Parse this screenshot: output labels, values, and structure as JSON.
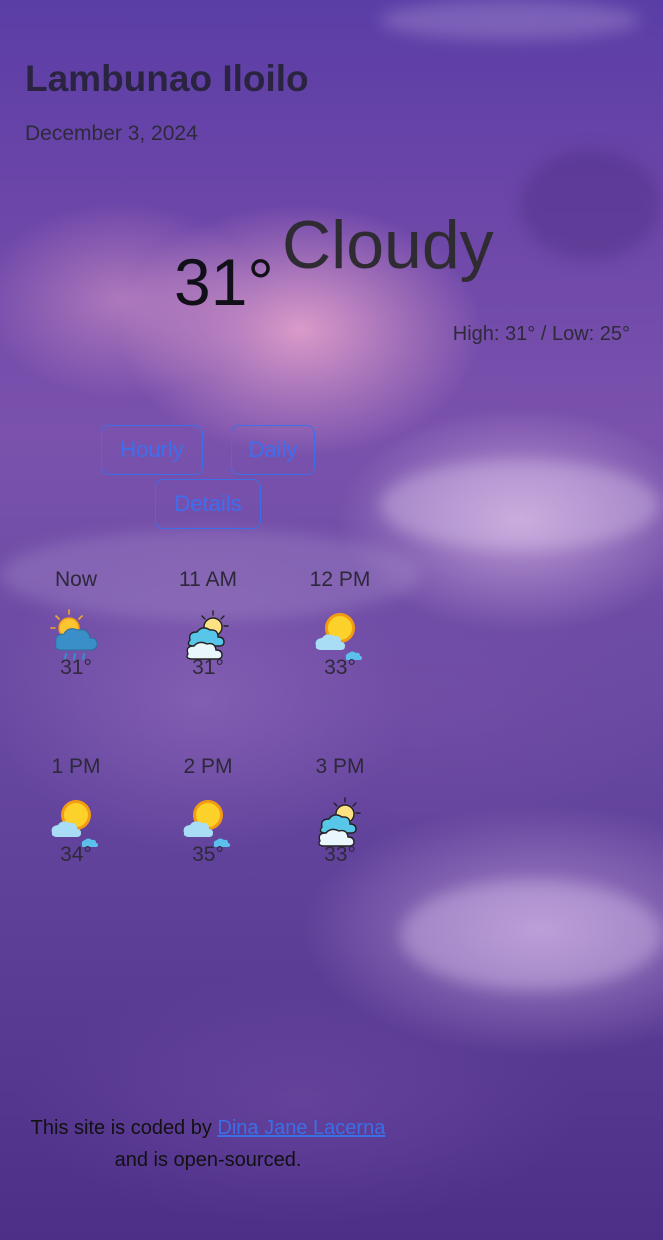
{
  "location": "Lambunao Iloilo",
  "date": "December 3, 2024",
  "current": {
    "temperature": "31°",
    "condition": "Cloudy",
    "high_low": "High: 31° / Low: 25°"
  },
  "tabs": {
    "hourly": "Hourly",
    "daily": "Daily",
    "details": "Details"
  },
  "hourly": [
    {
      "time": "Now",
      "icon": "sun-rain-cloud-icon",
      "temp": "31°"
    },
    {
      "time": "11 AM",
      "icon": "sun-behind-clouds-icon",
      "temp": "31°"
    },
    {
      "time": "12 PM",
      "icon": "sun-small-cloud-icon",
      "temp": "33°"
    },
    {
      "time": "1 PM",
      "icon": "sun-small-cloud-icon",
      "temp": "34°"
    },
    {
      "time": "2 PM",
      "icon": "sun-small-cloud-icon",
      "temp": "35°"
    },
    {
      "time": "3 PM",
      "icon": "sun-behind-clouds-icon",
      "temp": "33°"
    }
  ],
  "footer": {
    "prefix": "This site is coded by ",
    "author": "Dina Jane Lacerna",
    "suffix": "and is open-sourced."
  },
  "colors": {
    "accent": "#3c6fef",
    "background_top": "#5a3ea6",
    "background_bottom": "#4d2f88"
  }
}
